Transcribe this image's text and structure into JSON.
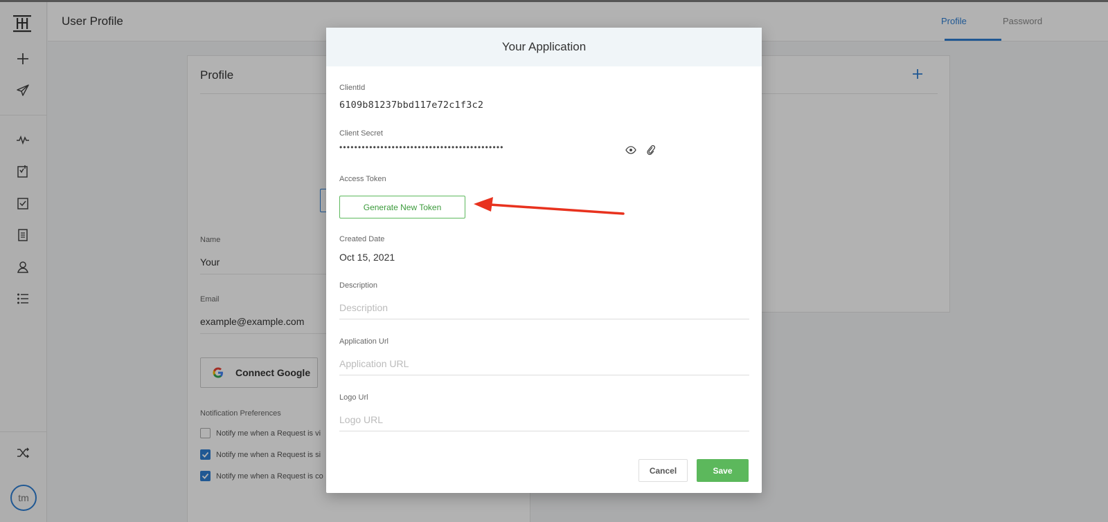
{
  "header": {
    "title": "User Profile",
    "tabs": [
      {
        "label": "Profile",
        "active": true
      },
      {
        "label": "Password",
        "active": false
      }
    ]
  },
  "rail": {
    "icons": [
      "logo-icon",
      "plus-icon",
      "send-icon",
      "activity-icon",
      "signed-doc-icon",
      "checklist-icon",
      "document-icon",
      "user-icon",
      "list-icon",
      "shuffle-icon"
    ],
    "avatar_initials": "tm"
  },
  "profile_card": {
    "title": "Profile",
    "name_label": "Name",
    "name_value": "Your",
    "email_label": "Email",
    "email_value": "example@example.com",
    "google_button": "Connect Google",
    "notif_title": "Notification Preferences",
    "notifications": [
      {
        "label": "Notify me when a Request is vi",
        "checked": false
      },
      {
        "label": "Notify me when a Request is si",
        "checked": true
      },
      {
        "label": "Notify me when a Request is co",
        "checked": true
      }
    ]
  },
  "modal": {
    "title": "Your Application",
    "client_id_label": "ClientId",
    "client_id": "6109b81237bbd117e72c1f3c2",
    "client_secret_label": "Client Secret",
    "client_secret_mask": "••••••••••••••••••••••••••••••••••••••••••••",
    "access_token_label": "Access Token",
    "generate_button": "Generate New Token",
    "created_label": "Created Date",
    "created_value": "Oct 15, 2021",
    "description_label": "Description",
    "description_placeholder": "Description",
    "app_url_label": "Application Url",
    "app_url_placeholder": "Application URL",
    "logo_url_label": "Logo Url",
    "logo_url_placeholder": "Logo URL",
    "cancel_label": "Cancel",
    "save_label": "Save"
  },
  "colors": {
    "accent": "#2f7fd3",
    "success": "#5cb85c",
    "arrow": "#e8321e"
  }
}
